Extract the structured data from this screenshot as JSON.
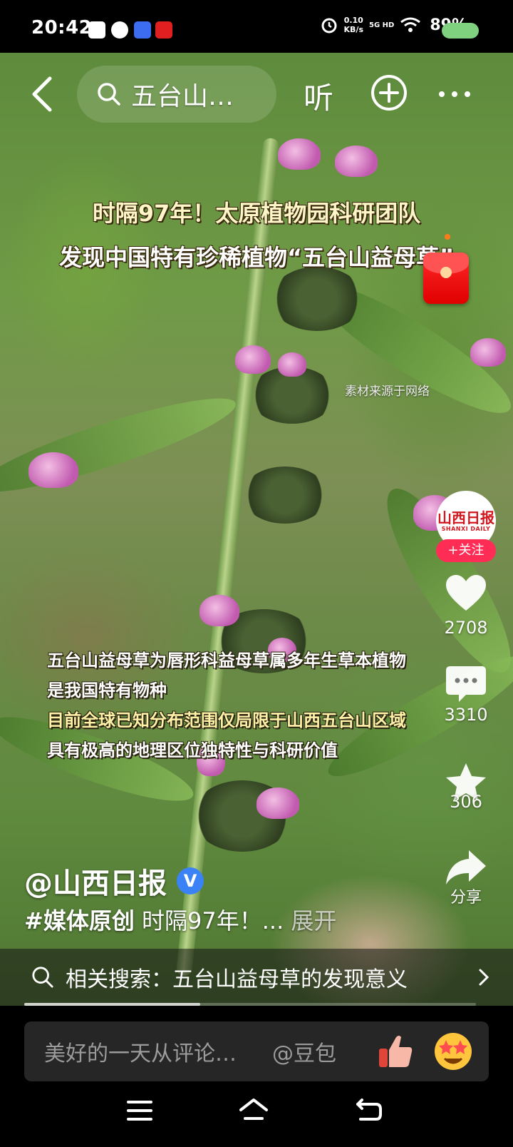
{
  "status_bar": {
    "time": "20:42",
    "net_speed_value": "0.10",
    "net_speed_unit": "KB/s",
    "network": "5G HD",
    "battery": "89%"
  },
  "nav": {
    "search_text": "五台山…",
    "listen_label": "听"
  },
  "headline": {
    "line1": "时隔97年！太原植物园科研团队",
    "line2": "发现中国特有珍稀植物“五台山益母草”"
  },
  "source_note": "素材来源于网络",
  "captions": [
    "五台山益母草为唇形科益母草属多年生草本植物",
    "是我国特有物种",
    "目前全球已知分布范围仅局限于山西五台山区域",
    "具有极高的地理区位独特性与科研价值"
  ],
  "author": {
    "avatar_main": "山西日报",
    "avatar_sub": "SHANXI DAILY",
    "follow_label": "+关注",
    "name": "@山西日报",
    "verified_mark": "V"
  },
  "rail": {
    "likes": "2708",
    "comments": "3310",
    "favorites": "306",
    "share_label": "分享"
  },
  "description": {
    "tag": "#媒体原创",
    "text": " 时隔97年！...",
    "more": " 展开"
  },
  "related": {
    "label": "相关搜索：五台山益母草的发现意义"
  },
  "progress": 0.39,
  "comment_bar": {
    "placeholder": "美好的一天从评论…",
    "mention": "@豆包"
  },
  "icons": [
    "back-icon",
    "search-icon",
    "add-circle-icon",
    "more-icon",
    "heart-icon",
    "comment-icon",
    "star-icon",
    "share-icon",
    "chevron-right-icon",
    "menu-icon",
    "home-icon",
    "back-nav-icon"
  ]
}
